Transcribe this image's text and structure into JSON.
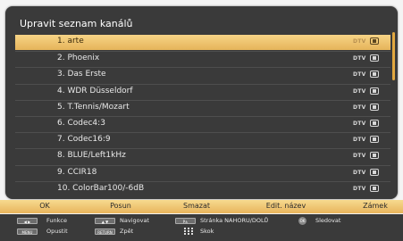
{
  "panel": {
    "title": "Upravit seznam kanálů",
    "rows": [
      {
        "name": "1. arte",
        "type": "DTV",
        "selected": true
      },
      {
        "name": "2. Phoenix",
        "type": "DTV",
        "selected": false
      },
      {
        "name": "3. Das Erste",
        "type": "DTV",
        "selected": false
      },
      {
        "name": "4. WDR Düsseldorf",
        "type": "DTV",
        "selected": false
      },
      {
        "name": "5. T.Tennis/Mozart",
        "type": "DTV",
        "selected": false
      },
      {
        "name": "6. Codec4:3",
        "type": "DTV",
        "selected": false
      },
      {
        "name": "7. Codec16:9",
        "type": "DTV",
        "selected": false
      },
      {
        "name": "8. BLUE/Left1kHz",
        "type": "DTV",
        "selected": false
      },
      {
        "name": "9. CCIR18",
        "type": "DTV",
        "selected": false
      },
      {
        "name": "10. ColorBar100/-6dB",
        "type": "DTV",
        "selected": false
      }
    ]
  },
  "function_bar": {
    "ok": "OK",
    "move": "Posun",
    "delete": "Smazat",
    "edit": "Edit. název",
    "lock": "Zámek"
  },
  "help": {
    "functions": "Funkce",
    "navigate": "Navigovat",
    "page": "Stránka NAHORU/DOLŮ",
    "watch": "Sledovat",
    "exit": "Opustit",
    "back": "Zpět",
    "jump": "Skok",
    "key_menu": "MENU",
    "key_return": "RETURN",
    "key_ok": "OK"
  },
  "colors": {
    "accent": "#f2c46e",
    "panel_bg": "#3a3a3a"
  }
}
